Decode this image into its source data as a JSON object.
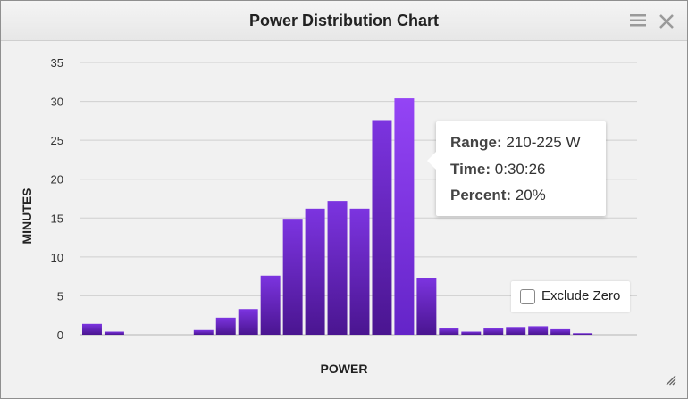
{
  "window": {
    "title": "Power Distribution Chart",
    "menu_icon": "hamburger-menu-icon",
    "close_icon": "close-icon",
    "resize_icon": "resize-grip-icon"
  },
  "tooltip": {
    "range_label": "Range:",
    "range_value": "210-225 W",
    "time_label": "Time:",
    "time_value": "0:30:26",
    "percent_label": "Percent:",
    "percent_value": "20%"
  },
  "exclude_zero": {
    "label": "Exclude Zero",
    "checked": false
  },
  "colors": {
    "bar_top": "#7c34e0",
    "bar_bottom": "#4a1590",
    "bar_highlight": "#8b3cf0",
    "grid": "#cfcfcf"
  },
  "chart_data": {
    "type": "bar",
    "xlabel": "POWER",
    "ylabel": "MINUTES",
    "ylim": [
      0,
      35
    ],
    "yticks": [
      0,
      5,
      10,
      15,
      20,
      25,
      30,
      35
    ],
    "grid": true,
    "highlighted_index": 14,
    "values": [
      1.4,
      0.4,
      0,
      0,
      0,
      0.6,
      2.2,
      3.3,
      7.6,
      14.9,
      16.2,
      17.2,
      16.2,
      27.6,
      30.4,
      7.3,
      0.8,
      0.4,
      0.8,
      1.0,
      1.1,
      0.7,
      0.2
    ]
  }
}
